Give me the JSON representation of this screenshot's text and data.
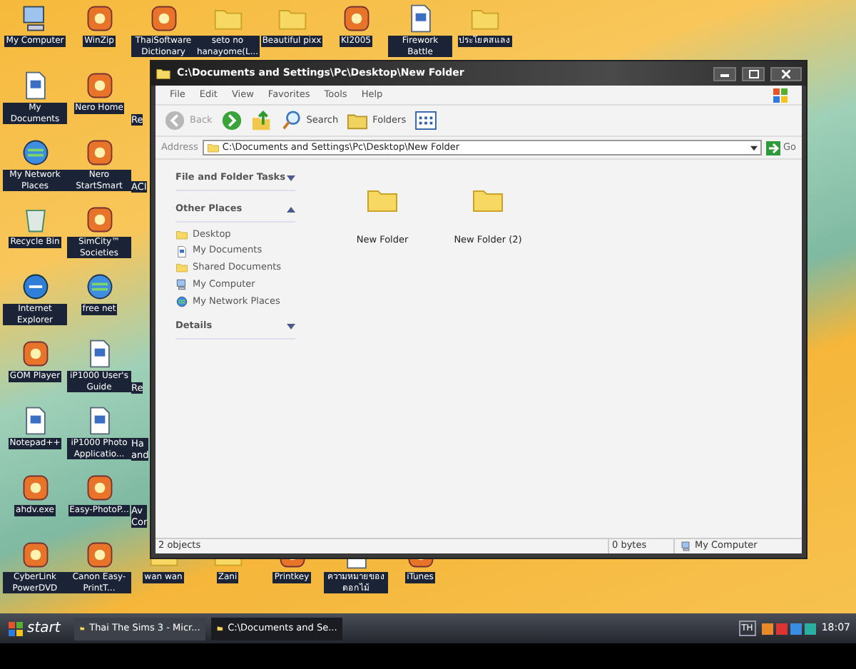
{
  "desktop": {
    "left_columns": [
      [
        {
          "label": "My Computer",
          "kind": "computer"
        },
        {
          "label": "My Documents",
          "kind": "document"
        },
        {
          "label": "My Network Places",
          "kind": "network"
        },
        {
          "label": "Recycle Bin",
          "kind": "bin"
        },
        {
          "label": "Internet Explorer",
          "kind": "browser"
        },
        {
          "label": "GOM Player",
          "kind": "app"
        },
        {
          "label": "Notepad++",
          "kind": "document"
        },
        {
          "label": "ahdv.exe",
          "kind": "app"
        },
        {
          "label": "CyberLink PowerDVD",
          "kind": "app"
        }
      ],
      [
        {
          "label": "WinZip",
          "kind": "app"
        },
        {
          "label": "Nero Home",
          "kind": "app"
        },
        {
          "label": "Nero StartSmart",
          "kind": "app"
        },
        {
          "label": "SimCity™ Societies",
          "kind": "app"
        },
        {
          "label": "free net",
          "kind": "network"
        },
        {
          "label": "iP1000 User's Guide",
          "kind": "book"
        },
        {
          "label": "iP1000 Photo Applicatio...",
          "kind": "book"
        },
        {
          "label": "Easy-PhotoP...",
          "kind": "app"
        },
        {
          "label": "Canon Easy-PrintT...",
          "kind": "app"
        }
      ]
    ],
    "partial_column": [
      {
        "kind": "label",
        "label": "Re"
      },
      {
        "kind": "label",
        "label": "ACI"
      },
      {
        "kind": "blank"
      },
      {
        "kind": "blank"
      },
      {
        "kind": "label",
        "label": "Re"
      },
      {
        "kind": "label",
        "label": "Ha and"
      },
      {
        "kind": "label",
        "label": "Av Cor"
      }
    ],
    "top_row": [
      {
        "label": "ThaiSoftware Dictionary",
        "kind": "app"
      },
      {
        "label": "seto no hanayome(L...",
        "kind": "folder"
      },
      {
        "label": "Beautiful pixx",
        "kind": "folder"
      },
      {
        "label": "KI2005",
        "kind": "app"
      },
      {
        "label": "Firework Battle",
        "kind": "document"
      },
      {
        "label": "ประโยคสแลง",
        "kind": "folder"
      }
    ],
    "bottom_row": [
      {
        "label": "wan wan",
        "kind": "folder"
      },
      {
        "label": "Zani",
        "kind": "folder"
      },
      {
        "label": "Printkey",
        "kind": "app"
      },
      {
        "label": "ความหมายของดอกไม้",
        "kind": "document"
      },
      {
        "label": "iTunes",
        "kind": "app"
      }
    ]
  },
  "window": {
    "title": "C:\\Documents and Settings\\Pc\\Desktop\\New Folder",
    "menu": [
      "File",
      "Edit",
      "View",
      "Favorites",
      "Tools",
      "Help"
    ],
    "toolbar": [
      {
        "label": "Back",
        "kind": "back",
        "disabled": true
      },
      {
        "kind": "forward"
      },
      {
        "kind": "up"
      },
      {
        "label": "Search",
        "kind": "search"
      },
      {
        "label": "Folders",
        "kind": "folders"
      },
      {
        "kind": "views"
      }
    ],
    "address": {
      "label": "Address",
      "value": "C:\\Documents and Settings\\Pc\\Desktop\\New Folder",
      "go": "Go"
    },
    "panels": [
      {
        "title": "File and Folder Tasks",
        "expanded": false
      },
      {
        "title": "Other Places",
        "expanded": true,
        "items": [
          {
            "label": "Desktop",
            "kind": "desktop"
          },
          {
            "label": "My Documents",
            "kind": "document"
          },
          {
            "label": "Shared Documents",
            "kind": "folder"
          },
          {
            "label": "My Computer",
            "kind": "computer"
          },
          {
            "label": "My Network Places",
            "kind": "network"
          }
        ]
      },
      {
        "title": "Details",
        "expanded": false
      }
    ],
    "files": [
      {
        "name": "New Folder"
      },
      {
        "name": "New Folder (2)"
      }
    ],
    "status_bar": {
      "objects": "2 objects",
      "size": "0 bytes",
      "zone": "My Computer"
    }
  },
  "taskbar": {
    "start": "start",
    "tasks": [
      {
        "label": "Thai The Sims 3 - Micr...",
        "selected": false
      },
      {
        "label": "C:\\Documents and Se...",
        "selected": true
      }
    ],
    "language": "TH",
    "time": "18:07"
  }
}
